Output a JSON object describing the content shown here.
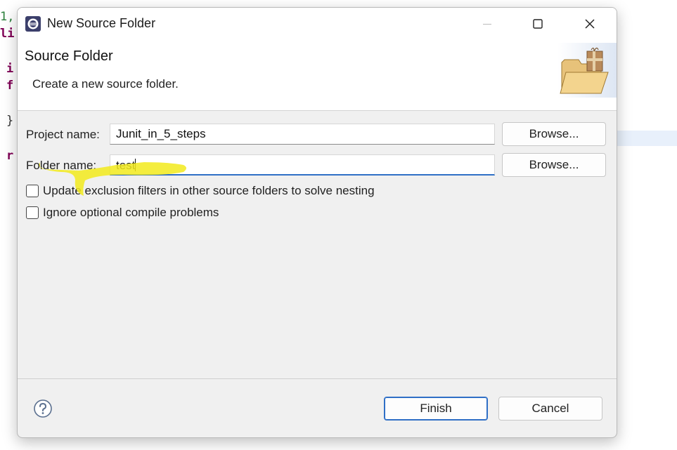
{
  "background_editor": {
    "lines": [
      "1,",
      "li",
      "i",
      "f",
      "}",
      "r"
    ]
  },
  "window": {
    "title": "New Source Folder",
    "icons": {
      "app": "eclipse-icon",
      "minimize": "minimize-icon",
      "maximize": "maximize-icon",
      "close": "close-icon"
    }
  },
  "header": {
    "title": "Source Folder",
    "description": "Create a new source folder.",
    "icon": "source-folder-package-icon"
  },
  "form": {
    "project": {
      "label": "Project name:",
      "value": "Junit_in_5_steps",
      "browse_label": "Browse..."
    },
    "folder": {
      "label": "Folder name:",
      "value": "test",
      "browse_label": "Browse..."
    },
    "options": [
      {
        "label": "Update exclusion filters in other source folders to solve nesting",
        "checked": false
      },
      {
        "label": "Ignore optional compile problems",
        "checked": false
      }
    ]
  },
  "footer": {
    "help_icon": "help-icon",
    "finish_label": "Finish",
    "cancel_label": "Cancel"
  },
  "colors": {
    "accent": "#2f6fc6",
    "highlighter": "#f2ea1c"
  }
}
